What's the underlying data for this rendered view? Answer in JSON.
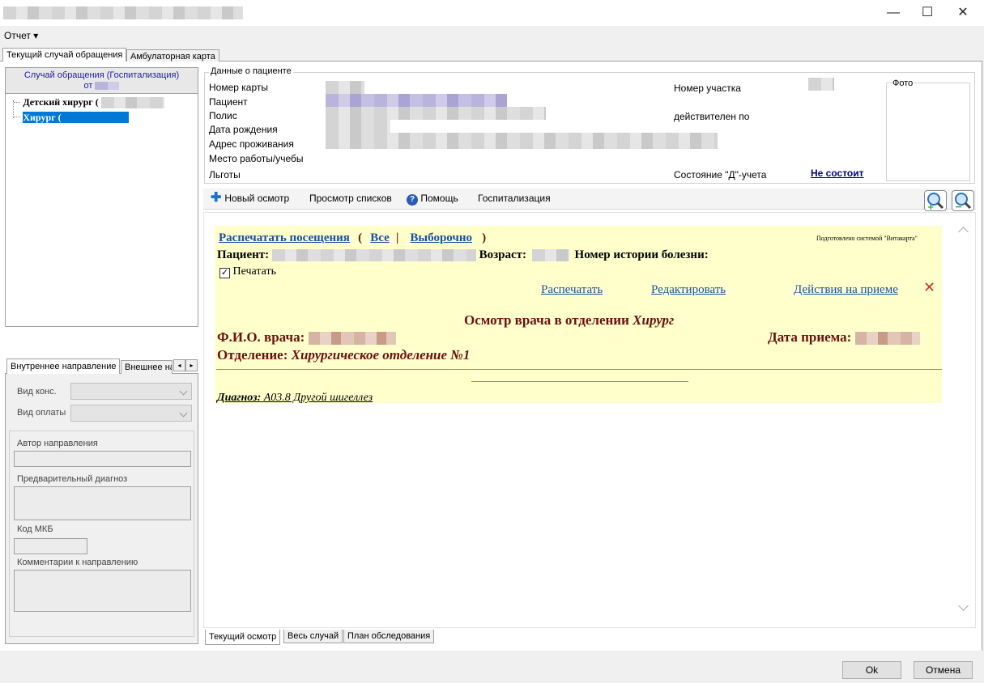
{
  "window": {
    "minimize": "—",
    "maximize": "☐",
    "close": "✕"
  },
  "menu": {
    "report": "Отчет ▾"
  },
  "tabs_top": [
    "Текущий случай обращения",
    "Амбулаторная карта"
  ],
  "left": {
    "case_header": "Случай обращения (Госпитализация)",
    "case_from": "от",
    "tree": [
      {
        "label": "Детский хирург ("
      },
      {
        "label": "Хирург ("
      }
    ],
    "dir_tabs": [
      "Внутреннее направление",
      "Внешнее на"
    ],
    "vid_kons": "Вид конс.",
    "vid_oplaty": "Вид оплаты",
    "author": "Автор направления",
    "prelim_diag": "Предварительный диагноз",
    "mkb": "Код МКБ",
    "comments": "Комментарии к направлению"
  },
  "patient": {
    "group_title": "Данные о пациенте",
    "card_no": "Номер карты",
    "patient": "Пациент",
    "polis": "Полис",
    "dob": "Дата рождения",
    "address": "Адрес проживания",
    "work": "Место работы/учебы",
    "benefits": "Льготы",
    "district": "Номер участка",
    "valid_to": "действителен по",
    "d_status_label": "Состояние \"Д\"-учета",
    "d_status_value": "Не состоит",
    "photo": "Фото"
  },
  "toolbar": {
    "new_exam": "Новый осмотр",
    "view_lists": "Просмотр списков",
    "help": "Помощь",
    "hospitalization": "Госпитализация"
  },
  "report": {
    "print_visits": "Распечатать посещения",
    "open_paren": "(",
    "all": "Все",
    "sep": "|",
    "selective": "Выборочно",
    "close_paren": ")",
    "prepared_by": "Подготовлено системой \"Витакарта\"",
    "patient_label": "Пациент:",
    "age_label": "Возраст:",
    "history_label": "Номер истории болезни:",
    "print_check": "Печатать",
    "print_link": "Распечатать",
    "edit_link": "Редактировать",
    "actions_link": "Действия на приеме",
    "exam_title": "Осмотр врача в отделении",
    "exam_dept": "Хирург",
    "doctor_label": "Ф.И.О. врача:",
    "date_label": "Дата приема:",
    "dept_label": "Отделение:",
    "dept_value": "Хирургическое отделение №1",
    "diag_label": "Диагноз:",
    "diag_value": "A03.8 Другой шигеллез"
  },
  "bottom_tabs": [
    "Текущий осмотр",
    "Весь случай",
    "План обследования"
  ],
  "buttons": {
    "ok": "Ok",
    "cancel": "Отмена"
  }
}
